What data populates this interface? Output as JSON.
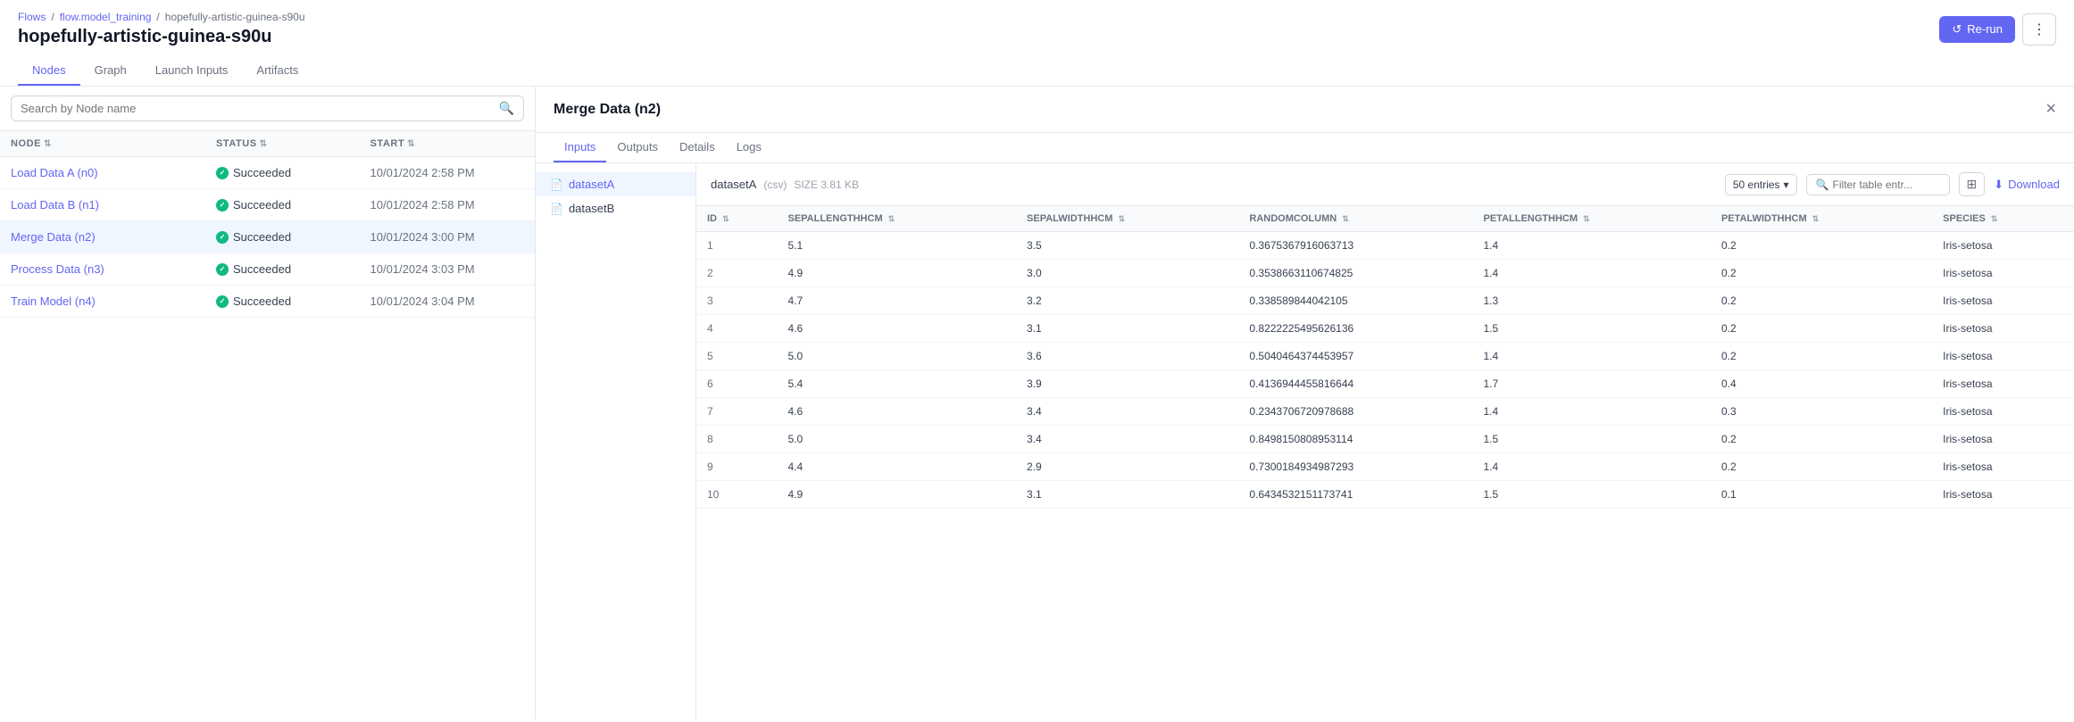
{
  "breadcrumb": {
    "flows": "Flows",
    "sep1": "/",
    "model_training": "flow.model_training",
    "sep2": "/",
    "run_id": "hopefully-artistic-guinea-s90u"
  },
  "page_title": "hopefully-artistic-guinea-s90u",
  "header_actions": {
    "rerun_label": "Re-run",
    "more_label": "⋮"
  },
  "tabs": [
    {
      "id": "nodes",
      "label": "Nodes",
      "active": true
    },
    {
      "id": "graph",
      "label": "Graph",
      "active": false
    },
    {
      "id": "launch_inputs",
      "label": "Launch Inputs",
      "active": false
    },
    {
      "id": "artifacts",
      "label": "Artifacts",
      "active": false
    }
  ],
  "left_table": {
    "columns": [
      {
        "key": "node",
        "label": "NODE"
      },
      {
        "key": "status",
        "label": "STATUS"
      },
      {
        "key": "start",
        "label": "START"
      }
    ],
    "rows": [
      {
        "node": "Load Data A (n0)",
        "status": "Succeeded",
        "start": "10/01/2024 2:58 PM",
        "active": false
      },
      {
        "node": "Load Data B (n1)",
        "status": "Succeeded",
        "start": "10/01/2024 2:58 PM",
        "active": false
      },
      {
        "node": "Merge Data (n2)",
        "status": "Succeeded",
        "start": "10/01/2024 3:00 PM",
        "active": true
      },
      {
        "node": "Process Data (n3)",
        "status": "Succeeded",
        "start": "10/01/2024 3:03 PM",
        "active": false
      },
      {
        "node": "Train Model (n4)",
        "status": "Succeeded",
        "start": "10/01/2024 3:04 PM",
        "active": false
      }
    ],
    "search_placeholder": "Search by Node name"
  },
  "detail": {
    "title": "Merge Data (n2)",
    "tabs": [
      {
        "id": "inputs",
        "label": "Inputs",
        "active": true
      },
      {
        "id": "outputs",
        "label": "Outputs",
        "active": false
      },
      {
        "id": "details",
        "label": "Details",
        "active": false
      },
      {
        "id": "logs",
        "label": "Logs",
        "active": false
      }
    ],
    "files": [
      {
        "name": "datasetA",
        "type": "csv",
        "active": true
      },
      {
        "name": "datasetB",
        "type": "file",
        "active": false
      }
    ],
    "data_view": {
      "filename": "datasetA",
      "filetype": "(csv)",
      "filesize": "SIZE 3.81 KB",
      "entries": "50 entries",
      "filter_placeholder": "Filter table entr...",
      "download_label": "Download",
      "columns": [
        "ID",
        "SEPALLENGTHHCM",
        "SEPALWIDTHHCM",
        "RANDOMCOLUMN",
        "PETALLENGTHHCM",
        "PETALWIDTHHCM",
        "SPECIES"
      ],
      "rows": [
        {
          "id": "1",
          "sepal_len": "5.1",
          "sepal_wid": "3.5",
          "random": "0.3675367916063713",
          "petal_len": "1.4",
          "petal_wid": "0.2",
          "species": "Iris-setosa"
        },
        {
          "id": "2",
          "sepal_len": "4.9",
          "sepal_wid": "3.0",
          "random": "0.3538663110674825",
          "petal_len": "1.4",
          "petal_wid": "0.2",
          "species": "Iris-setosa"
        },
        {
          "id": "3",
          "sepal_len": "4.7",
          "sepal_wid": "3.2",
          "random": "0.338589844042105",
          "petal_len": "1.3",
          "petal_wid": "0.2",
          "species": "Iris-setosa"
        },
        {
          "id": "4",
          "sepal_len": "4.6",
          "sepal_wid": "3.1",
          "random": "0.8222225495626136",
          "petal_len": "1.5",
          "petal_wid": "0.2",
          "species": "Iris-setosa"
        },
        {
          "id": "5",
          "sepal_len": "5.0",
          "sepal_wid": "3.6",
          "random": "0.5040464374453957",
          "petal_len": "1.4",
          "petal_wid": "0.2",
          "species": "Iris-setosa"
        },
        {
          "id": "6",
          "sepal_len": "5.4",
          "sepal_wid": "3.9",
          "random": "0.4136944455816644",
          "petal_len": "1.7",
          "petal_wid": "0.4",
          "species": "Iris-setosa"
        },
        {
          "id": "7",
          "sepal_len": "4.6",
          "sepal_wid": "3.4",
          "random": "0.2343706720978688",
          "petal_len": "1.4",
          "petal_wid": "0.3",
          "species": "Iris-setosa"
        },
        {
          "id": "8",
          "sepal_len": "5.0",
          "sepal_wid": "3.4",
          "random": "0.8498150808953114",
          "petal_len": "1.5",
          "petal_wid": "0.2",
          "species": "Iris-setosa"
        },
        {
          "id": "9",
          "sepal_len": "4.4",
          "sepal_wid": "2.9",
          "random": "0.7300184934987293",
          "petal_len": "1.4",
          "petal_wid": "0.2",
          "species": "Iris-setosa"
        },
        {
          "id": "10",
          "sepal_len": "4.9",
          "sepal_wid": "3.1",
          "random": "0.6434532151173741",
          "petal_len": "1.5",
          "petal_wid": "0.1",
          "species": "Iris-setosa"
        }
      ]
    }
  }
}
